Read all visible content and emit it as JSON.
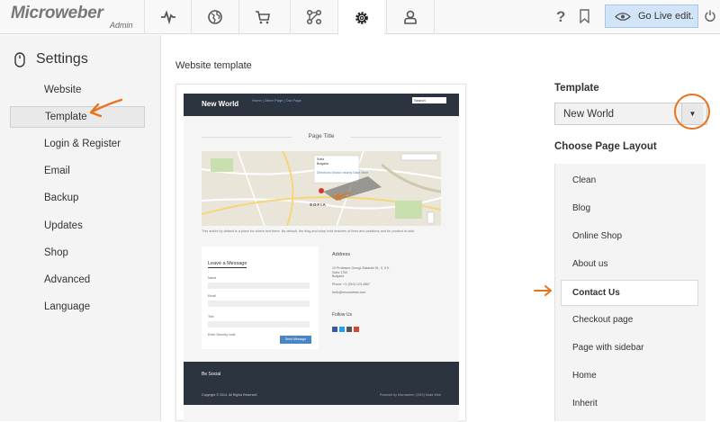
{
  "app": {
    "logo": "Microweber",
    "logo_sub": "Admin",
    "help": "?",
    "go_live": "Go Live edit."
  },
  "sidebar": {
    "title": "Settings",
    "items": [
      {
        "label": "Website"
      },
      {
        "label": "Template"
      },
      {
        "label": "Login & Register"
      },
      {
        "label": "Email"
      },
      {
        "label": "Backup"
      },
      {
        "label": "Updates"
      },
      {
        "label": "Shop"
      },
      {
        "label": "Advanced"
      },
      {
        "label": "Language"
      }
    ],
    "active": "Template"
  },
  "main": {
    "section_label": "Website template"
  },
  "preview": {
    "brand": "New World",
    "nav_links": "Home | Other Page | Our Page",
    "search_text": "Search",
    "page_title": "Page Title",
    "map_place": "SOFIA",
    "map_card": [
      "Sofia",
      "Bulgaria",
      "Directions  Search nearby  Save  More"
    ],
    "lorem": "This article by default is a place for admin text there. By default, the blog and shop hold features of lines and positions and for product to add.",
    "form_title": "Leave a Message",
    "form_labels": [
      "Name",
      "Email",
      "Text",
      "Enter Security code"
    ],
    "send_button": "Send Message",
    "address_title": "Address",
    "address_lines": [
      "10 Professor Georgi Zlatarski St., 5, 5 fl.",
      "Sofia 1700",
      "Bulgaria",
      "Phone: +1 (910) 123-4567",
      "hello@microweber.com"
    ],
    "follow_title": "Follow Us",
    "be_social": "Be Social",
    "copyright": "Copyright © 2014, All Rights Reserved",
    "powered": "Powered by Microweber (CMS) Make Web"
  },
  "right": {
    "template_label": "Template",
    "template_value": "New World",
    "layout_label": "Choose Page Layout",
    "layouts": [
      {
        "label": "Clean"
      },
      {
        "label": "Blog"
      },
      {
        "label": "Online Shop"
      },
      {
        "label": "About us"
      },
      {
        "label": "Contact Us"
      },
      {
        "label": "Checkout page"
      },
      {
        "label": "Page with sidebar"
      },
      {
        "label": "Home"
      },
      {
        "label": "Inherit"
      }
    ],
    "selected_layout": "Contact Us"
  },
  "colors": {
    "accent_orange": "#e8731d",
    "go_live_bg": "#d2e4f7",
    "preview_dark": "#2c3440"
  },
  "icons": {
    "nav": [
      "pulse-icon",
      "globe-icon",
      "cart-icon",
      "modules-icon",
      "gear-icon",
      "user-icon"
    ]
  }
}
